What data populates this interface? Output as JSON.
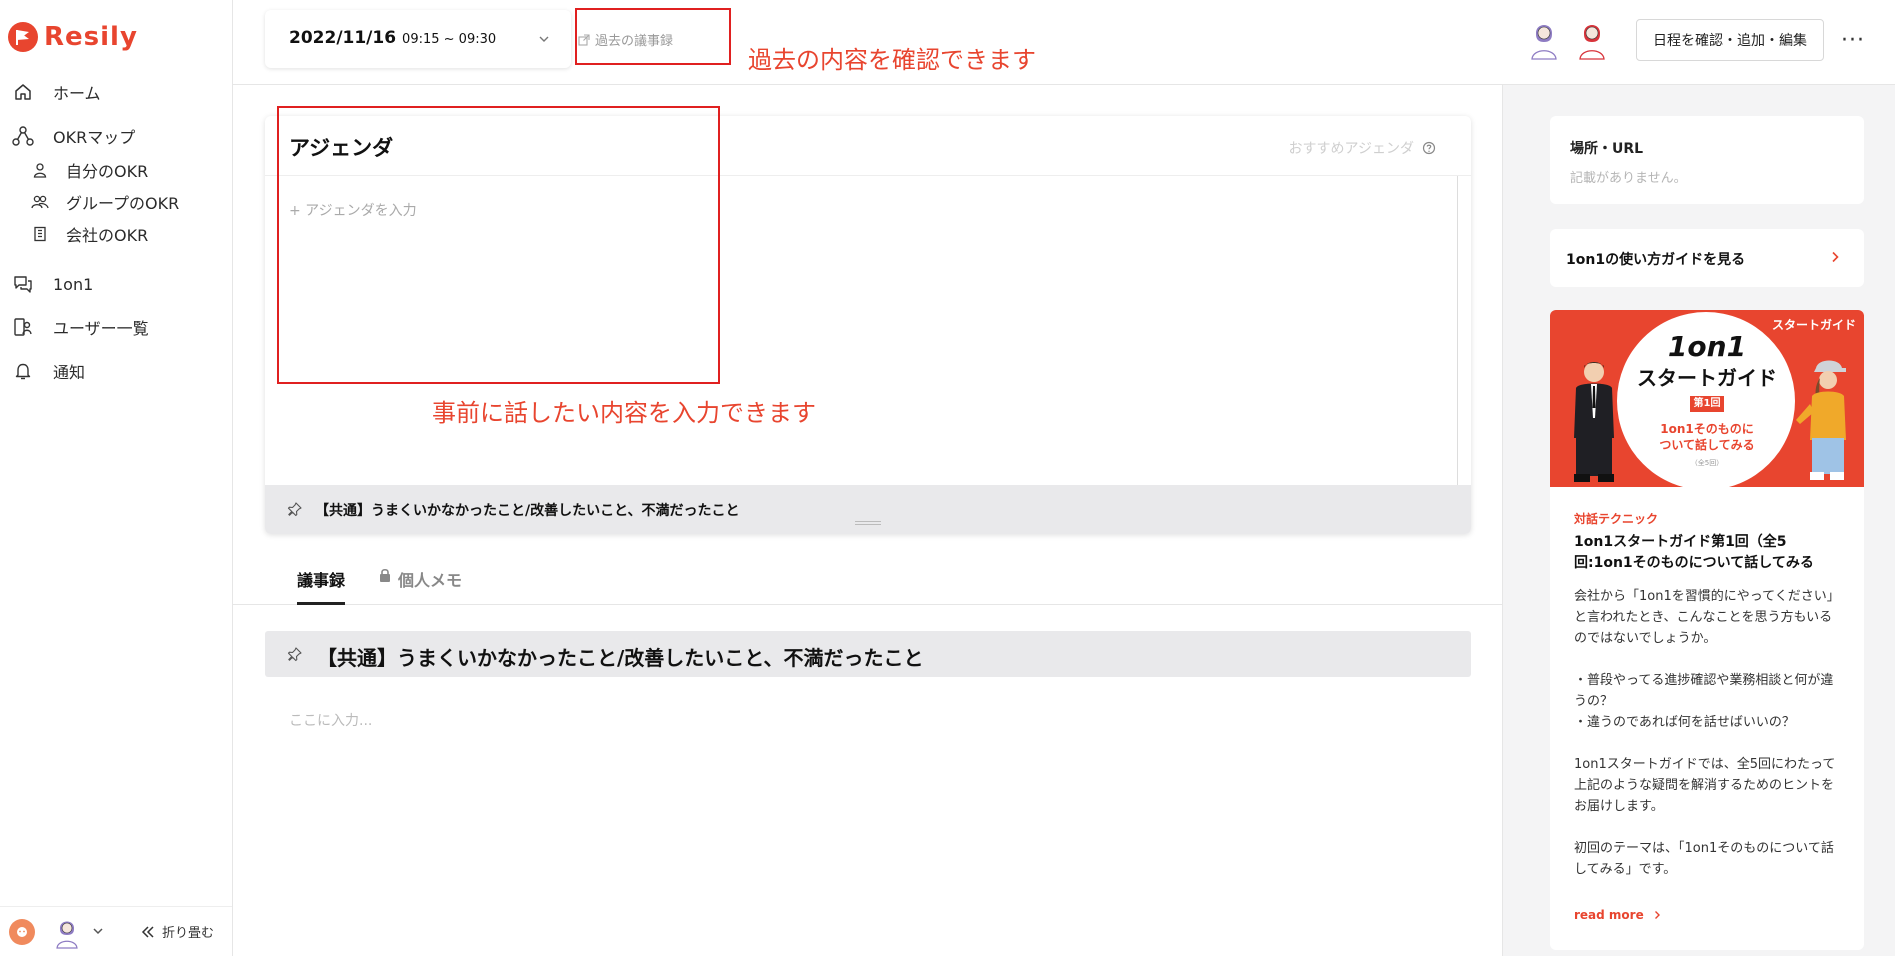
{
  "brand": {
    "name": "Resily",
    "accent": "#e8452f"
  },
  "sidebar": {
    "items": [
      {
        "label": "ホーム",
        "icon": "home-icon"
      },
      {
        "label": "OKRマップ",
        "icon": "okr-map-icon"
      },
      {
        "label": "自分のOKR",
        "icon": "user-icon"
      },
      {
        "label": "グループのOKR",
        "icon": "group-icon"
      },
      {
        "label": "会社のOKR",
        "icon": "building-icon"
      },
      {
        "label": "1on1",
        "icon": "chat-icon"
      },
      {
        "label": "ユーザー一覧",
        "icon": "users-list-icon"
      },
      {
        "label": "通知",
        "icon": "bell-icon"
      }
    ],
    "collapse_label": "折り畳む"
  },
  "topbar": {
    "date": "2022/11/16",
    "time": "09:15 ~ 09:30",
    "past_minutes_label": "過去の議事録",
    "annotation_past": "過去の内容を確認できます",
    "schedule_button": "日程を確認・追加・編集",
    "more_label": "···"
  },
  "agenda": {
    "title": "アジェンダ",
    "recommended_label": "おすすめアジェンダ",
    "input_placeholder": "+ アジェンダを入力",
    "pinned_item": "【共通】うまくいかなかったこと/改善したいこと、不満だったこと",
    "annotation": "事前に話したい内容を入力できます"
  },
  "tabs": [
    {
      "label": "議事録",
      "active": true
    },
    {
      "label": "個人メモ",
      "active": false
    }
  ],
  "minutes": {
    "heading": "【共通】うまくいかなかったこと/改善したいこと、不満だったこと",
    "placeholder": "ここに入力..."
  },
  "right_panel": {
    "location": {
      "title": "場所・URL",
      "value": "記載がありません。"
    },
    "guide_link": "1on1の使い方ガイドを見る",
    "article": {
      "banner_tag": "スタートガイド",
      "banner_title1": "1on1",
      "banner_title2": "スタートガイド",
      "banner_episode": "第1回",
      "banner_sub1": "1on1そのものに",
      "banner_sub2": "ついて話してみる",
      "banner_sub3": "（全5回）",
      "category": "対話テクニック",
      "title": "1on1スタートガイド第1回（全5回:1on1そのものについて話してみる",
      "body": [
        "会社から「1on1を習慣的にやってください」と言われたとき、こんなことを思う方もいるのではないでしょうか。",
        "",
        "・普段やってる進捗確認や業務相談と何が違うの？",
        "・違うのであれば何を話せばいいの？",
        "",
        "1on1スタートガイドでは、全5回にわたって上記のような疑問を解消するためのヒントをお届けします。",
        "",
        "初回のテーマは、「1on1そのものについて話してみる」です。"
      ],
      "read_more": "read more"
    }
  }
}
